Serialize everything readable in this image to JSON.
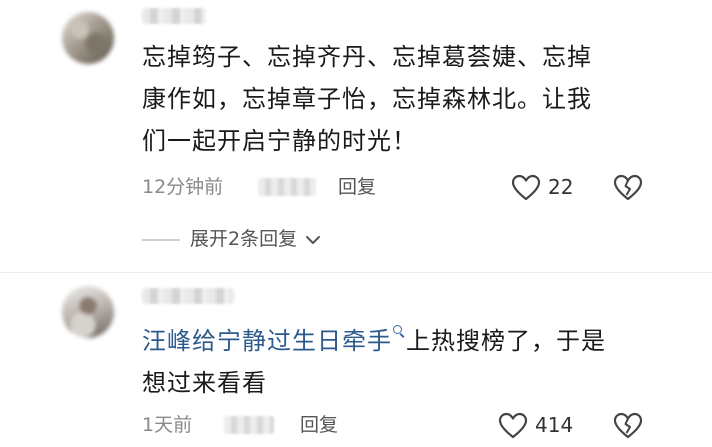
{
  "comments": [
    {
      "text": "忘掉筠子、忘掉齐丹、忘掉葛荟婕、忘掉",
      "text_line2": "康作如，忘掉章子怡，忘掉森林北。让我",
      "text_line3": "们一起开启宁静的时光！",
      "time": "12分钟前",
      "reply_label": "回复",
      "likes": "22",
      "expand_label": "展开2条回复"
    },
    {
      "link_text": "汪峰给宁静过生日牵手",
      "text_rest": "上热搜榜了，于是",
      "text_line2": "想过来看看",
      "time": "1天前",
      "reply_label": "回复",
      "likes": "414"
    }
  ]
}
